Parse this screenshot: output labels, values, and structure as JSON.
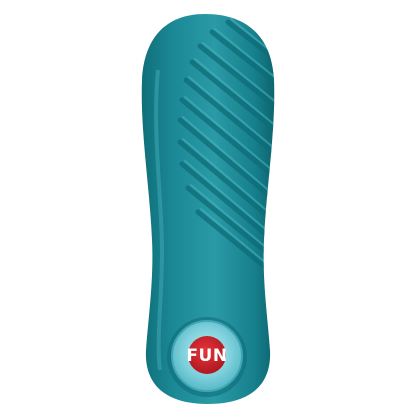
{
  "image": {
    "background_color": "#ffffff"
  },
  "product": {
    "body_color": "#1b8a96",
    "body_shadow_color": "#0f6f7a",
    "body_highlight_color": "#3aa7b2",
    "ridge_color": "#137c88",
    "button_ring_color": "#5ec2cf",
    "button_inner_color": "#8fd8e2",
    "logo_badge_color": "#c9202a",
    "logo_text_color": "#ffffff",
    "logo_text": "FUN"
  }
}
